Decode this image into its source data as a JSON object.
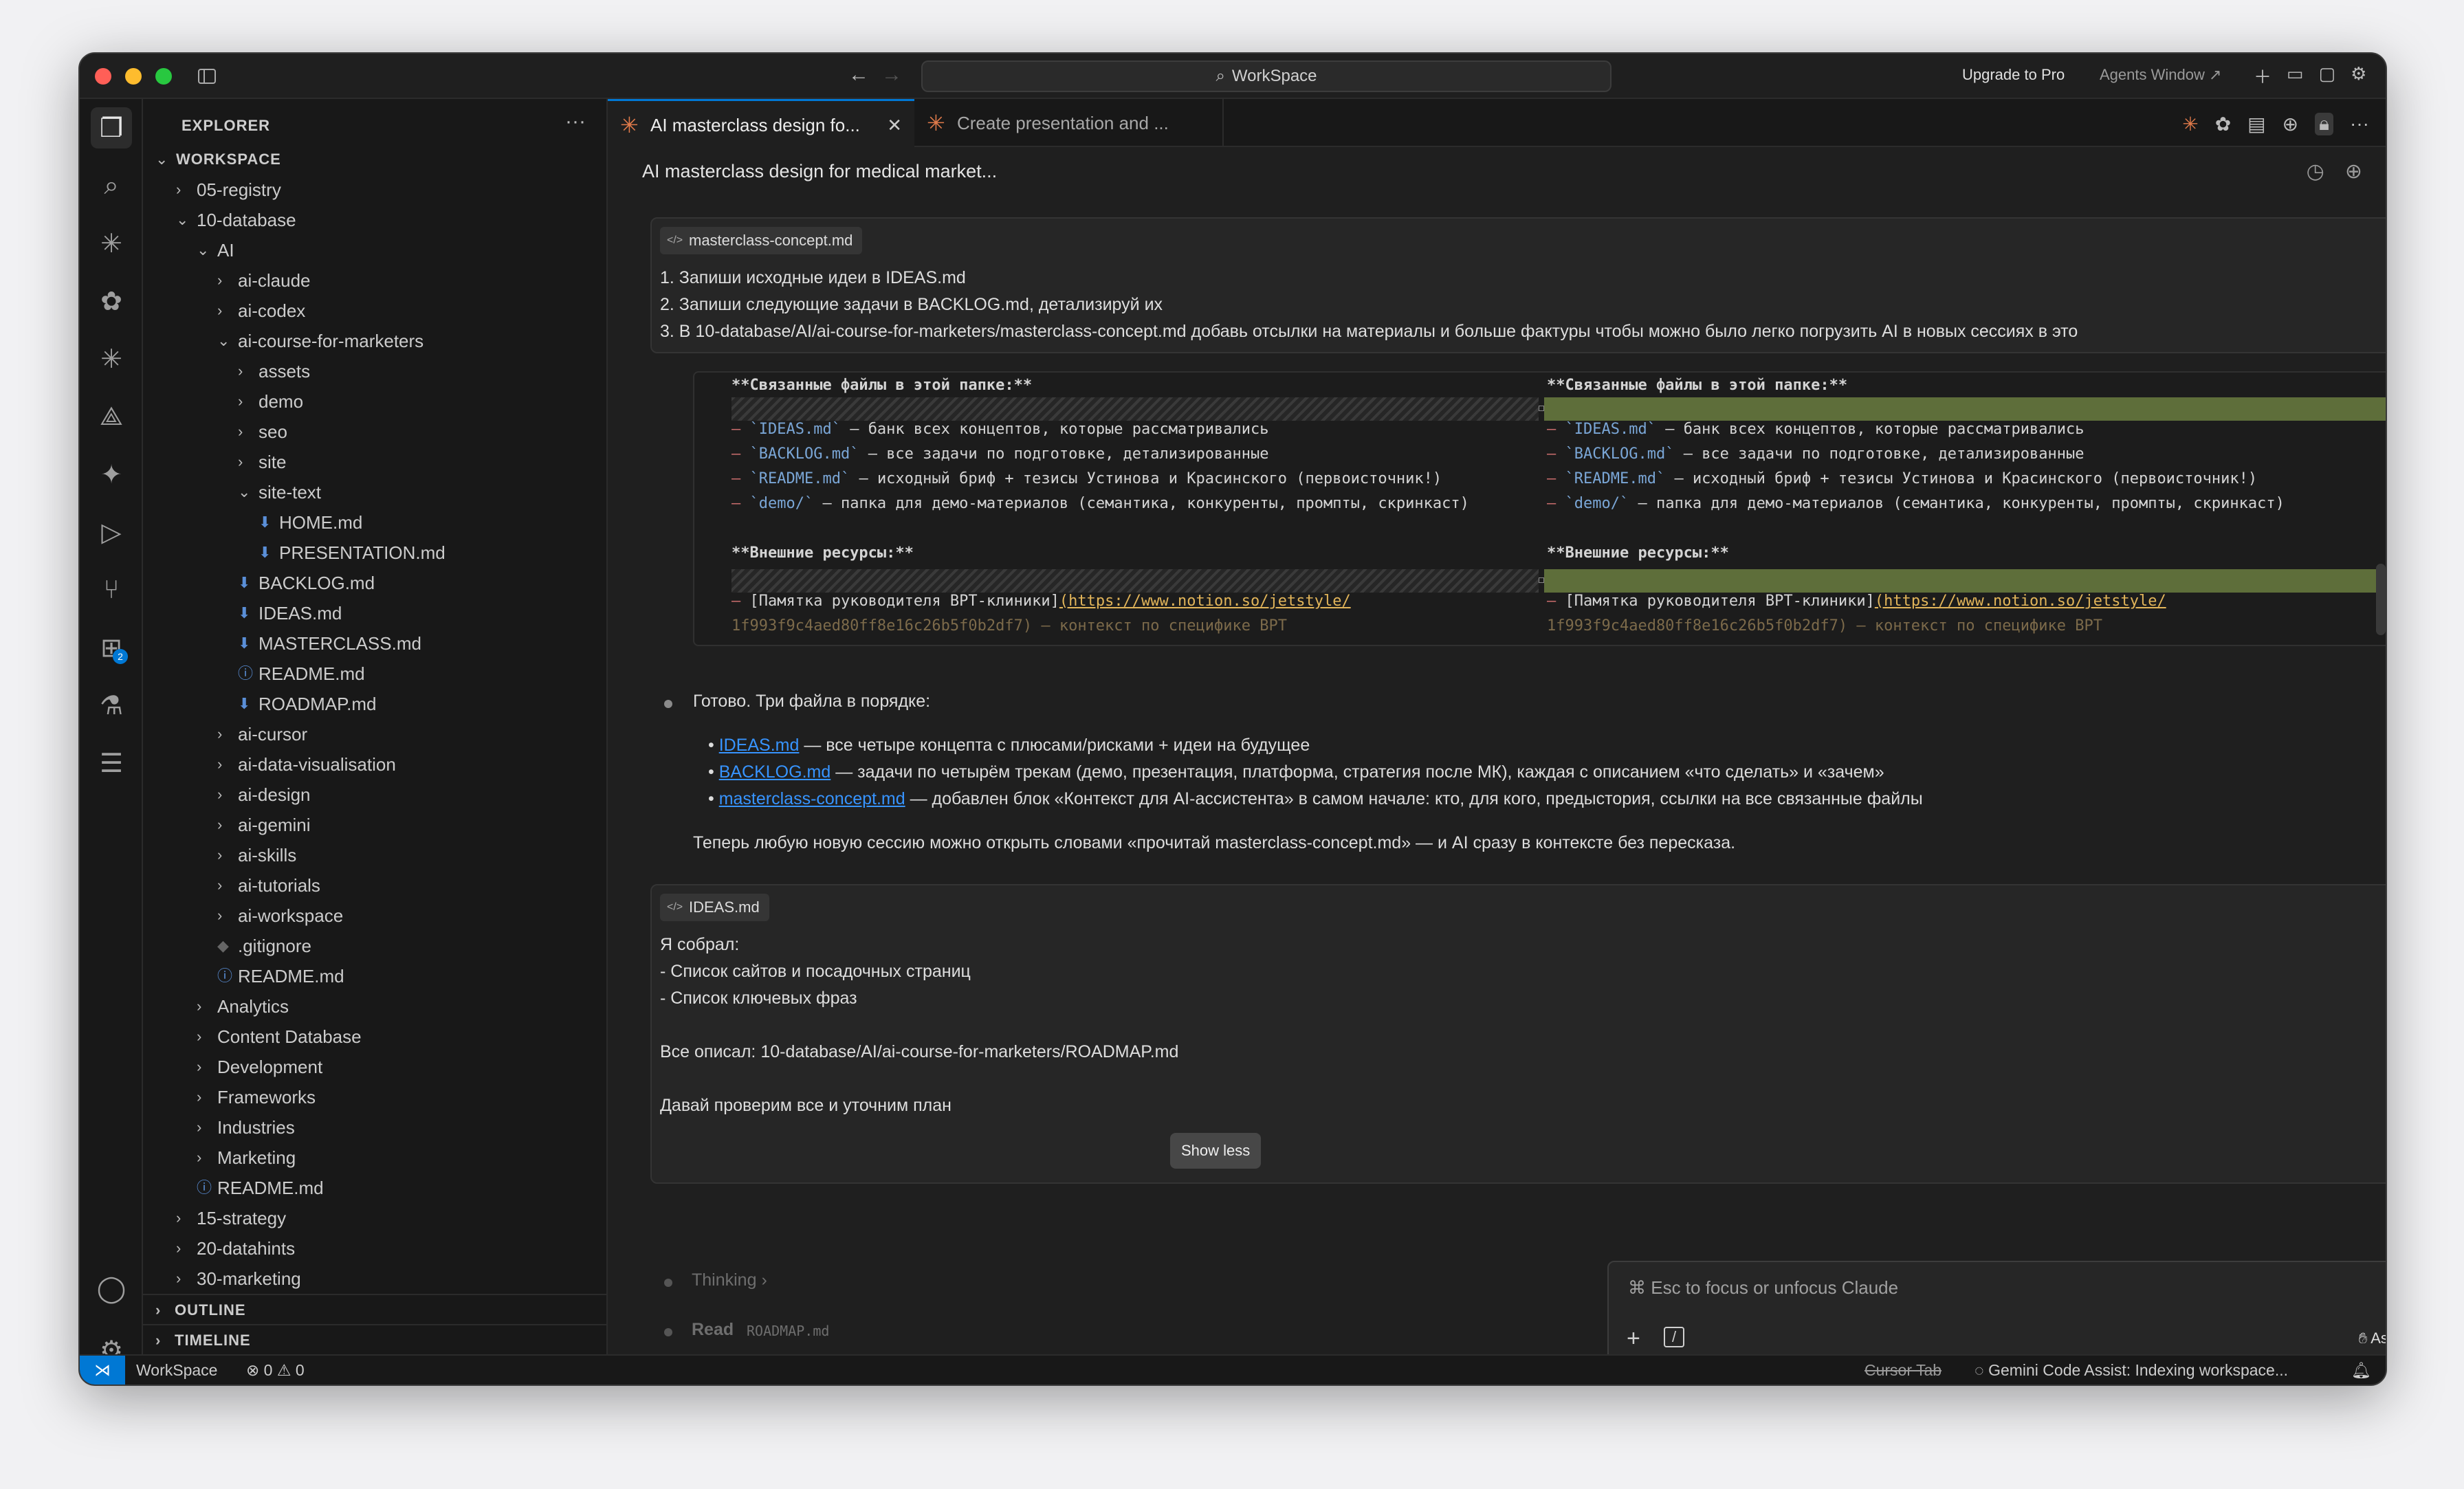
{
  "titlebar": {
    "search": "WorkSpace",
    "upgrade": "Upgrade to Pro",
    "agents_window": "Agents Window ↗"
  },
  "sidebar": {
    "title": "EXPLORER",
    "more": "···",
    "tree": [
      {
        "label": "WORKSPACE",
        "depth": 0,
        "type": "section",
        "expanded": true
      },
      {
        "label": "05-registry",
        "depth": 1,
        "type": "folder",
        "expanded": false
      },
      {
        "label": "10-database",
        "depth": 1,
        "type": "folder",
        "expanded": true
      },
      {
        "label": "AI",
        "depth": 2,
        "type": "folder",
        "expanded": true
      },
      {
        "label": "ai-claude",
        "depth": 3,
        "type": "folder",
        "expanded": false
      },
      {
        "label": "ai-codex",
        "depth": 3,
        "type": "folder",
        "expanded": false
      },
      {
        "label": "ai-course-for-marketers",
        "depth": 3,
        "type": "folder",
        "expanded": true
      },
      {
        "label": "assets",
        "depth": 4,
        "type": "folder",
        "expanded": false
      },
      {
        "label": "demo",
        "depth": 4,
        "type": "folder",
        "expanded": false
      },
      {
        "label": "seo",
        "depth": 4,
        "type": "folder",
        "expanded": false
      },
      {
        "label": "site",
        "depth": 4,
        "type": "folder",
        "expanded": false
      },
      {
        "label": "site-text",
        "depth": 4,
        "type": "folder",
        "expanded": true
      },
      {
        "label": "HOME.md",
        "depth": 5,
        "type": "md"
      },
      {
        "label": "PRESENTATION.md",
        "depth": 5,
        "type": "md"
      },
      {
        "label": "BACKLOG.md",
        "depth": 4,
        "type": "md"
      },
      {
        "label": "IDEAS.md",
        "depth": 4,
        "type": "md"
      },
      {
        "label": "MASTERCLASS.md",
        "depth": 4,
        "type": "md"
      },
      {
        "label": "README.md",
        "depth": 4,
        "type": "info"
      },
      {
        "label": "ROADMAP.md",
        "depth": 4,
        "type": "md"
      },
      {
        "label": "ai-cursor",
        "depth": 3,
        "type": "folder",
        "expanded": false
      },
      {
        "label": "ai-data-visualisation",
        "depth": 3,
        "type": "folder",
        "expanded": false
      },
      {
        "label": "ai-design",
        "depth": 3,
        "type": "folder",
        "expanded": false
      },
      {
        "label": "ai-gemini",
        "depth": 3,
        "type": "folder",
        "expanded": false
      },
      {
        "label": "ai-skills",
        "depth": 3,
        "type": "folder",
        "expanded": false
      },
      {
        "label": "ai-tutorials",
        "depth": 3,
        "type": "folder",
        "expanded": false
      },
      {
        "label": "ai-workspace",
        "depth": 3,
        "type": "folder",
        "expanded": false
      },
      {
        "label": ".gitignore",
        "depth": 3,
        "type": "git"
      },
      {
        "label": "README.md",
        "depth": 3,
        "type": "info"
      },
      {
        "label": "Analytics",
        "depth": 2,
        "type": "folder",
        "expanded": false
      },
      {
        "label": "Content Database",
        "depth": 2,
        "type": "folder",
        "expanded": false
      },
      {
        "label": "Development",
        "depth": 2,
        "type": "folder",
        "expanded": false
      },
      {
        "label": "Frameworks",
        "depth": 2,
        "type": "folder",
        "expanded": false
      },
      {
        "label": "Industries",
        "depth": 2,
        "type": "folder",
        "expanded": false
      },
      {
        "label": "Marketing",
        "depth": 2,
        "type": "folder",
        "expanded": false
      },
      {
        "label": "README.md",
        "depth": 2,
        "type": "info"
      },
      {
        "label": "15-strategy",
        "depth": 1,
        "type": "folder",
        "expanded": false
      },
      {
        "label": "20-datahints",
        "depth": 1,
        "type": "folder",
        "expanded": false
      },
      {
        "label": "30-marketing",
        "depth": 1,
        "type": "folder",
        "expanded": false
      }
    ],
    "outline": "OUTLINE",
    "timeline": "TIMELINE"
  },
  "tabs": [
    {
      "label": "AI masterclass design fo...",
      "active": true
    },
    {
      "label": "Create presentation and ...",
      "active": false
    }
  ],
  "conversation": {
    "title": "AI masterclass design for medical market...",
    "prompt1": {
      "file": "masterclass-concept.md",
      "lines": [
        "1. Запиши исходные идеи в IDEAS.md",
        "2. Запиши следующие задачи в BACKLOG.md, детализируй их",
        "3. В 10-database/AI/ai-course-for-marketers/masterclass-concept.md добавь отсылки на материалы и больше фактуры чтобы можно было легко погрузить AI в новых сессиях в это"
      ]
    },
    "diff": {
      "heading1": "**Связанные файлы в этой папке:**",
      "item1_code": "`IDEAS.md`",
      "item1_text": " — банк всех концептов, которые рассматривались",
      "item2_code": "`BACKLOG.md`",
      "item2_text": " — все задачи по подготовке, детализированные",
      "item3_code": "`README.md`",
      "item3_text": " — исходный бриф + тезисы Устинова и Красинского (первоисточник!)",
      "item4_code": "`demo/`",
      "item4_text": " — папка для демо-материалов (семантика, конкуренты, промпты, скринкаст)",
      "heading2": "**Внешние ресурсы:**",
      "link_text": "[Памятка руководителя ВРТ-клиники]",
      "link_url": "(https://www.notion.so/jetstyle/",
      "link_tail": "1f993f9c4aed80ff8e16c26b5f0b2df7) — контекст по специфике ВРТ"
    },
    "reply": {
      "intro": "Готово. Три файла в порядке:",
      "items": [
        {
          "link": "IDEAS.md",
          "text": " — все четыре концепта с плюсами/рисками + идеи на будущее"
        },
        {
          "link": "BACKLOG.md",
          "text": " — задачи по четырём трекам (демо, презентация, платформа, стратегия после МК), каждая с описанием «что сделать» и «зачем»"
        },
        {
          "link": "masterclass-concept.md",
          "text": " — добавлен блок «Контекст для AI-ассистента» в самом начале: кто, для кого, предыстория, ссылки на все связанные файлы"
        }
      ],
      "outro": "Теперь любую новую сессию можно открыть словами «прочитай masterclass-concept.md» — и AI сразу в контексте без пересказа."
    },
    "prompt2": {
      "file": "IDEAS.md",
      "lines": [
        "Я собрал:",
        "- Список сайтов и посадочных страниц",
        "- Список ключевых фраз",
        "Все описал: 10-database/AI/ai-course-for-marketers/ROADMAP.md",
        "Давай проверим все и уточним план"
      ],
      "show_less": "Show less"
    },
    "thinking": "Thinking",
    "read_label": "Read",
    "read_file": "ROADMAP.md"
  },
  "input": {
    "placeholder": "⌘ Esc to focus or unfocus Claude",
    "ask_before_edits": "Ask before edits"
  },
  "status": {
    "workspace": "WorkSpace",
    "problems": "⊗ 0 ⚠ 0",
    "cursor_tab": "Cursor Tab",
    "gemini": "Gemini Code Assist: Indexing workspace...",
    "extensions_badge": "2"
  }
}
